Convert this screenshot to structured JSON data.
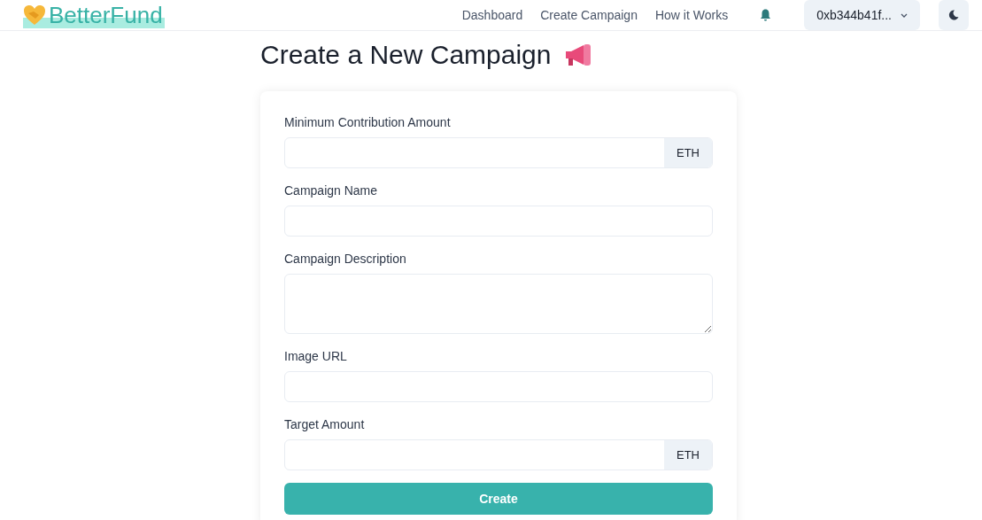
{
  "navbar": {
    "brand": "BetterFund",
    "links": [
      "Dashboard",
      "Create Campaign",
      "How it Works"
    ],
    "account": "0xb344b41f..."
  },
  "page_title": "Create a New Campaign",
  "form": {
    "fields": [
      {
        "label": "Minimum Contribution Amount",
        "kind": "input",
        "addon": "ETH"
      },
      {
        "label": "Campaign Name",
        "kind": "input"
      },
      {
        "label": "Campaign Description",
        "kind": "textarea"
      },
      {
        "label": "Image URL",
        "kind": "input"
      },
      {
        "label": "Target Amount",
        "kind": "input",
        "addon": "ETH"
      }
    ],
    "submit": "Create"
  }
}
